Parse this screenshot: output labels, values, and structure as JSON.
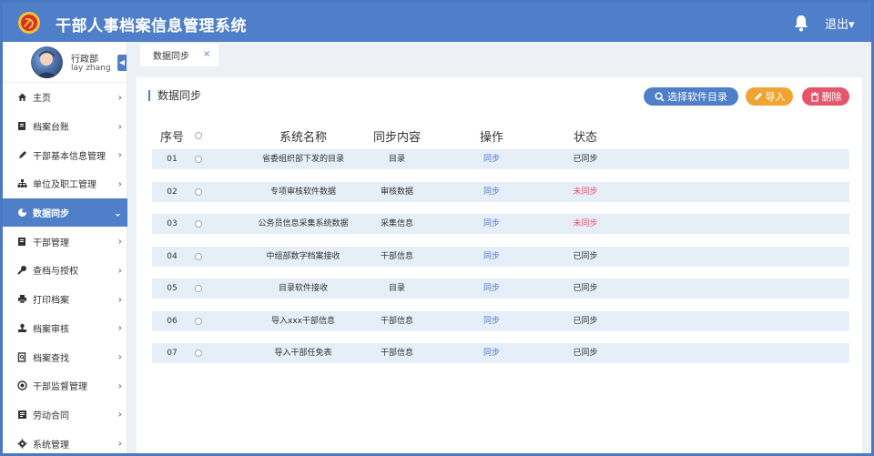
{
  "header": {
    "title": "干部人事档案信息管理系统",
    "logout": "退出▾",
    "icon": "party-emblem-icon",
    "bell_icon": "bell-icon"
  },
  "profile": {
    "role": "行政部",
    "name": "lay zhang"
  },
  "sidebar": {
    "items": [
      {
        "label": "主页",
        "icon": "home-icon",
        "active": false
      },
      {
        "label": "档案台账",
        "icon": "book-icon",
        "active": false
      },
      {
        "label": "干部基本信息管理",
        "icon": "pen-icon",
        "active": false
      },
      {
        "label": "单位及职工管理",
        "icon": "sitemap-icon",
        "active": false
      },
      {
        "label": "数据同步",
        "icon": "pie-chart-icon",
        "active": true
      },
      {
        "label": "干部管理",
        "icon": "book-icon",
        "active": false
      },
      {
        "label": "查档与授权",
        "icon": "key-icon",
        "active": false
      },
      {
        "label": "打印档案",
        "icon": "printer-icon",
        "active": false
      },
      {
        "label": "档案审核",
        "icon": "stamp-icon",
        "active": false
      },
      {
        "label": "档案查找",
        "icon": "search-doc-icon",
        "active": false
      },
      {
        "label": "干部监督管理",
        "icon": "eye-icon",
        "active": false
      },
      {
        "label": "劳动合同",
        "icon": "contract-icon",
        "active": false
      },
      {
        "label": "系统管理",
        "icon": "gear-icon",
        "active": false
      }
    ]
  },
  "tabs": [
    {
      "label": "数据同步",
      "close": "×"
    }
  ],
  "panel": {
    "title": "数据同步",
    "btn_select": "选择软件目录",
    "btn_import": "导入",
    "btn_delete": "删除"
  },
  "table": {
    "headers": {
      "index": "序号",
      "name": "系统名称",
      "content": "同步内容",
      "op": "操作",
      "status": "状态"
    },
    "rows": [
      {
        "index": "01",
        "name": "省委组织部下发的目录",
        "content": "目录",
        "op": "同步",
        "status": "已同步",
        "synced": true
      },
      {
        "index": "02",
        "name": "专项审核软件数据",
        "content": "审核数据",
        "op": "同步",
        "status": "未同步",
        "synced": false
      },
      {
        "index": "03",
        "name": "公务员信息采集系统数据",
        "content": "采集信息",
        "op": "同步",
        "status": "未同步",
        "synced": false
      },
      {
        "index": "04",
        "name": "中组部数字档案接收",
        "content": "干部信息",
        "op": "同步",
        "status": "已同步",
        "synced": true
      },
      {
        "index": "05",
        "name": "目录软件接收",
        "content": "目录",
        "op": "同步",
        "status": "已同步",
        "synced": true
      },
      {
        "index": "06",
        "name": "导入xxx干部信息",
        "content": "干部信息",
        "op": "同步",
        "status": "已同步",
        "synced": true
      },
      {
        "index": "07",
        "name": "导入干部任免表",
        "content": "干部信息",
        "op": "同步",
        "status": "已同步",
        "synced": true
      }
    ]
  },
  "colors": {
    "primary": "#4f7fc9",
    "warning": "#f0a533",
    "danger": "#e5556b",
    "row_bg": "#e6eef8"
  }
}
